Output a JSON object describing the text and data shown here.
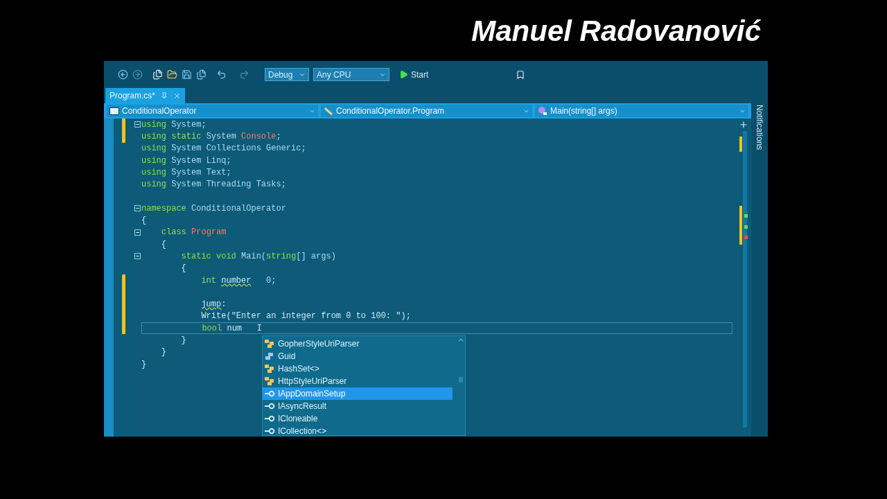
{
  "overlay_title": "Manuel Radovanović",
  "toolbar": {
    "configuration": "Debug",
    "platform": "Any CPU",
    "start": "Start"
  },
  "tabs": [
    {
      "label": "Program.cs*",
      "selected": true
    }
  ],
  "navigation": [
    {
      "kind": "project",
      "value": "ConditionalOperator"
    },
    {
      "kind": "class",
      "value": "ConditionalOperator.Program"
    },
    {
      "kind": "method",
      "value": "Main(string[] args)"
    }
  ],
  "side_panel": "Notifications",
  "code_lines": [
    {
      "fold": true,
      "modified": true,
      "current": false,
      "tokens": [
        {
          "text": "using",
          "kind": "keyword"
        },
        {
          "text": " System;",
          "kind": "name"
        }
      ]
    },
    {
      "fold": false,
      "modified": true,
      "current": false,
      "tokens": [
        {
          "text": "using static",
          "kind": "keyword"
        },
        {
          "text": " System ",
          "kind": "name"
        },
        {
          "text": "Console",
          "kind": "class"
        },
        {
          "text": ";",
          "kind": "name"
        }
      ]
    },
    {
      "fold": false,
      "modified": false,
      "current": false,
      "tokens": [
        {
          "text": "using",
          "kind": "keyword"
        },
        {
          "text": " System Collections Generic;",
          "kind": "name"
        }
      ]
    },
    {
      "fold": false,
      "modified": false,
      "current": false,
      "tokens": [
        {
          "text": "using",
          "kind": "keyword"
        },
        {
          "text": " System Linq;",
          "kind": "name"
        }
      ]
    },
    {
      "fold": false,
      "modified": false,
      "current": false,
      "tokens": [
        {
          "text": "using",
          "kind": "keyword"
        },
        {
          "text": " System Text;",
          "kind": "name"
        }
      ]
    },
    {
      "fold": false,
      "modified": false,
      "current": false,
      "tokens": [
        {
          "text": "using",
          "kind": "keyword"
        },
        {
          "text": " System Threading Tasks;",
          "kind": "name"
        }
      ]
    },
    {
      "fold": false,
      "modified": false,
      "current": false
    },
    {
      "fold": true,
      "modified": false,
      "current": false,
      "tokens": [
        {
          "text": "namespace",
          "kind": "keyword"
        },
        {
          "text": " ConditionalOperator",
          "kind": "name"
        }
      ]
    },
    {
      "fold": false,
      "modified": false,
      "current": false,
      "tokens": [
        {
          "text": "{",
          "kind": "plain"
        }
      ]
    },
    {
      "fold": true,
      "modified": false,
      "current": false,
      "tokens": [
        {
          "text": "    class",
          "kind": "keyword"
        },
        {
          "text": " Program",
          "kind": "class"
        }
      ]
    },
    {
      "fold": false,
      "modified": false,
      "current": false,
      "tokens": [
        {
          "text": "    {",
          "kind": "plain"
        }
      ]
    },
    {
      "fold": true,
      "modified": false,
      "current": false,
      "tokens": [
        {
          "text": "        static void",
          "kind": "keyword"
        },
        {
          "text": " Main(",
          "kind": "name"
        },
        {
          "text": "string",
          "kind": "keyword"
        },
        {
          "text": "[] args)",
          "kind": "name"
        }
      ]
    },
    {
      "fold": false,
      "modified": false,
      "current": false,
      "tokens": [
        {
          "text": "        {",
          "kind": "plain"
        }
      ]
    },
    {
      "fold": false,
      "modified": true,
      "current": false,
      "tokens": [
        {
          "text": "            int ",
          "kind": "keyword"
        },
        {
          "text": "number",
          "kind": "squiggle"
        },
        {
          "text": "   0;",
          "kind": "name"
        }
      ]
    },
    {
      "fold": false,
      "modified": true,
      "current": false
    },
    {
      "fold": false,
      "modified": true,
      "current": false,
      "tokens": [
        {
          "text": "            jump",
          "kind": "squiggle"
        },
        {
          "text": ":",
          "kind": "plain"
        }
      ]
    },
    {
      "fold": false,
      "modified": true,
      "current": false,
      "tokens": [
        {
          "text": "            Write(\"Enter an integer from 0 to 100: \");",
          "kind": "plain"
        }
      ]
    },
    {
      "fold": false,
      "modified": true,
      "current": true,
      "tokens": [
        {
          "text": "            bool",
          "kind": "keyword"
        },
        {
          "text": " num   I",
          "kind": "plain"
        }
      ]
    },
    {
      "fold": false,
      "modified": false,
      "current": false,
      "tokens": [
        {
          "text": "        }",
          "kind": "plain"
        }
      ]
    },
    {
      "fold": false,
      "modified": false,
      "current": false,
      "tokens": [
        {
          "text": "    }",
          "kind": "plain"
        }
      ]
    },
    {
      "fold": false,
      "modified": false,
      "current": false,
      "tokens": [
        {
          "text": "}",
          "kind": "plain"
        }
      ]
    }
  ],
  "completion": [
    {
      "kind": "class",
      "label": "GopherStyleUriParser",
      "selected": false
    },
    {
      "kind": "struct",
      "label": "Guid",
      "selected": false
    },
    {
      "kind": "class",
      "label": "HashSet<>",
      "selected": false
    },
    {
      "kind": "class",
      "label": "HttpStyleUriParser",
      "selected": false
    },
    {
      "kind": "interface",
      "label": "IAppDomainSetup",
      "selected": true
    },
    {
      "kind": "interface",
      "label": "IAsyncResult",
      "selected": false
    },
    {
      "kind": "interface",
      "label": "ICloneable",
      "selected": false
    },
    {
      "kind": "interface",
      "label": "ICollection<>",
      "selected": false
    }
  ]
}
